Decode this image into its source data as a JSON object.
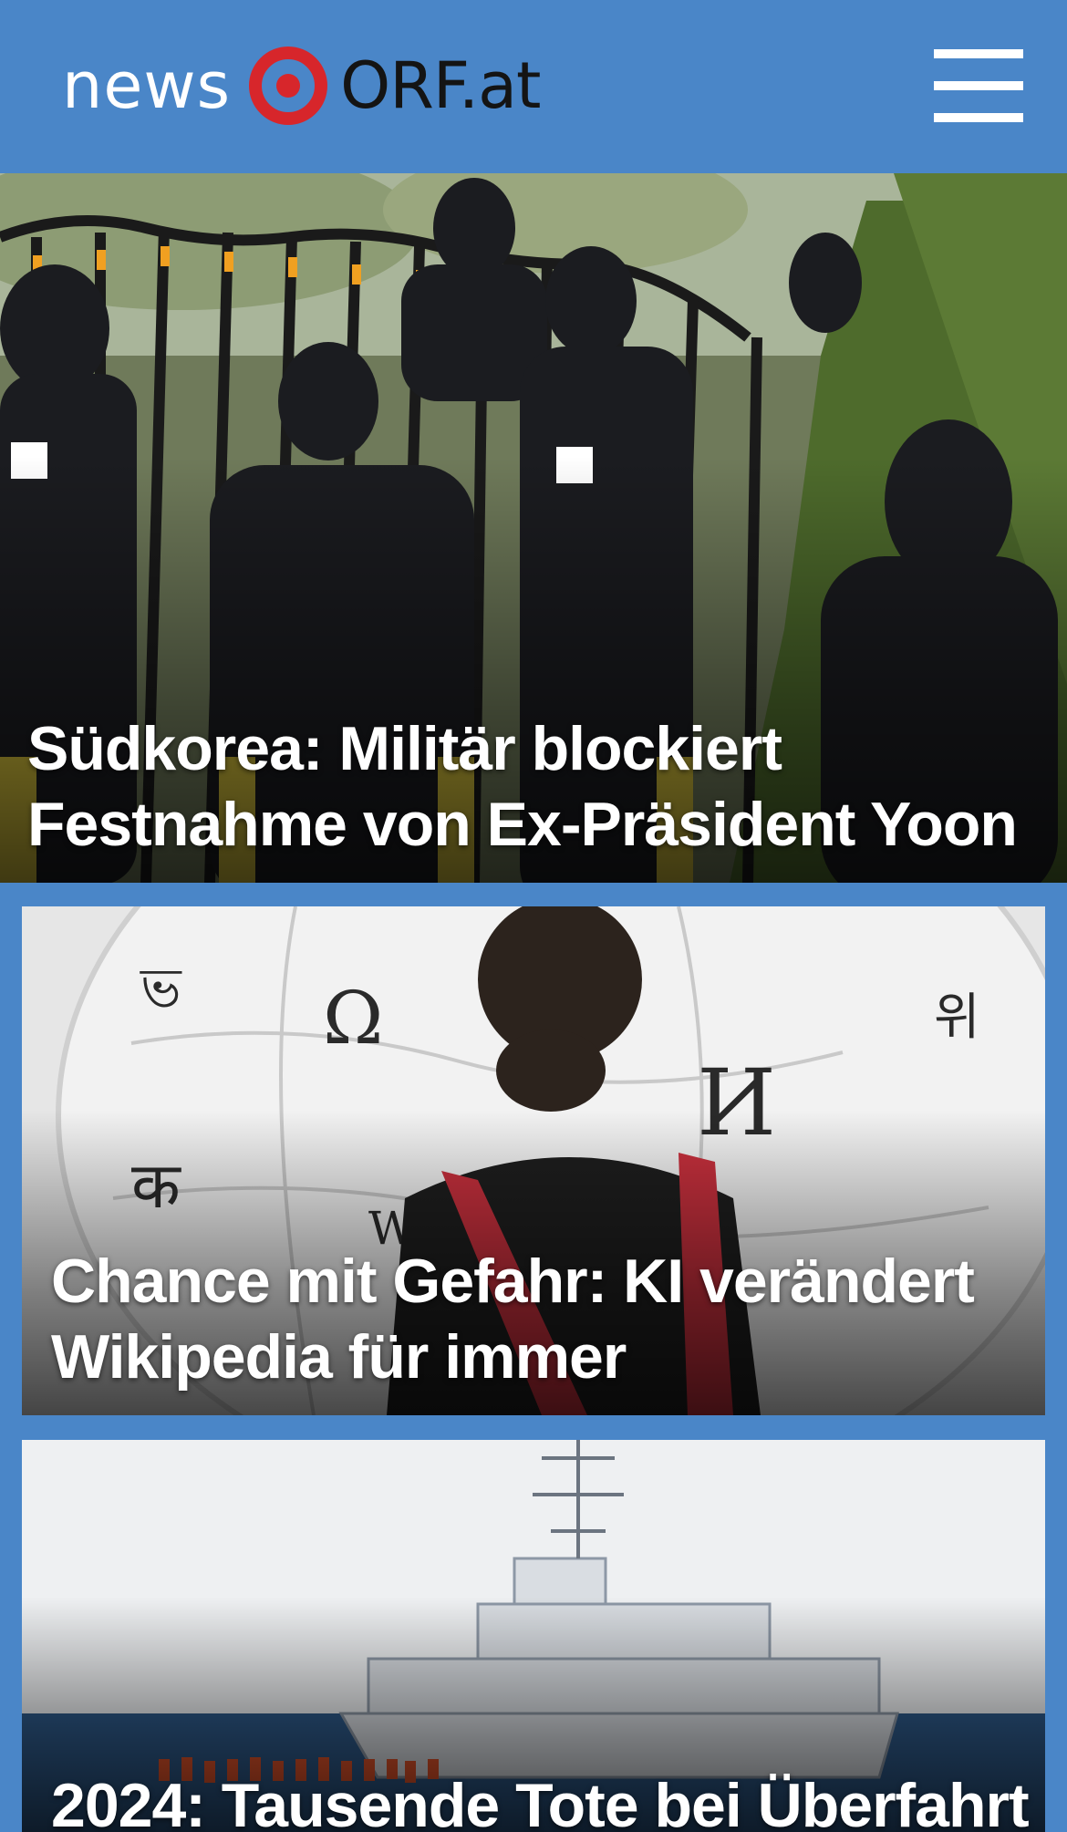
{
  "app": {
    "logo_left": "news",
    "logo_right": "ORF.at"
  },
  "header": {
    "menu_icon": "hamburger-menu-icon"
  },
  "colors": {
    "header_bg": "#4a86c8",
    "brand_red": "#d7262b",
    "headline_text": "#ffffff"
  },
  "stories": [
    {
      "headline": "Südkorea: Militär blockiert Festnahme von Ex-Präsident Yoon"
    },
    {
      "headline": "Chance mit Gefahr: KI verändert Wikipedia für immer"
    },
    {
      "headline": "2024: Tausende Tote bei Überfahrt"
    }
  ]
}
